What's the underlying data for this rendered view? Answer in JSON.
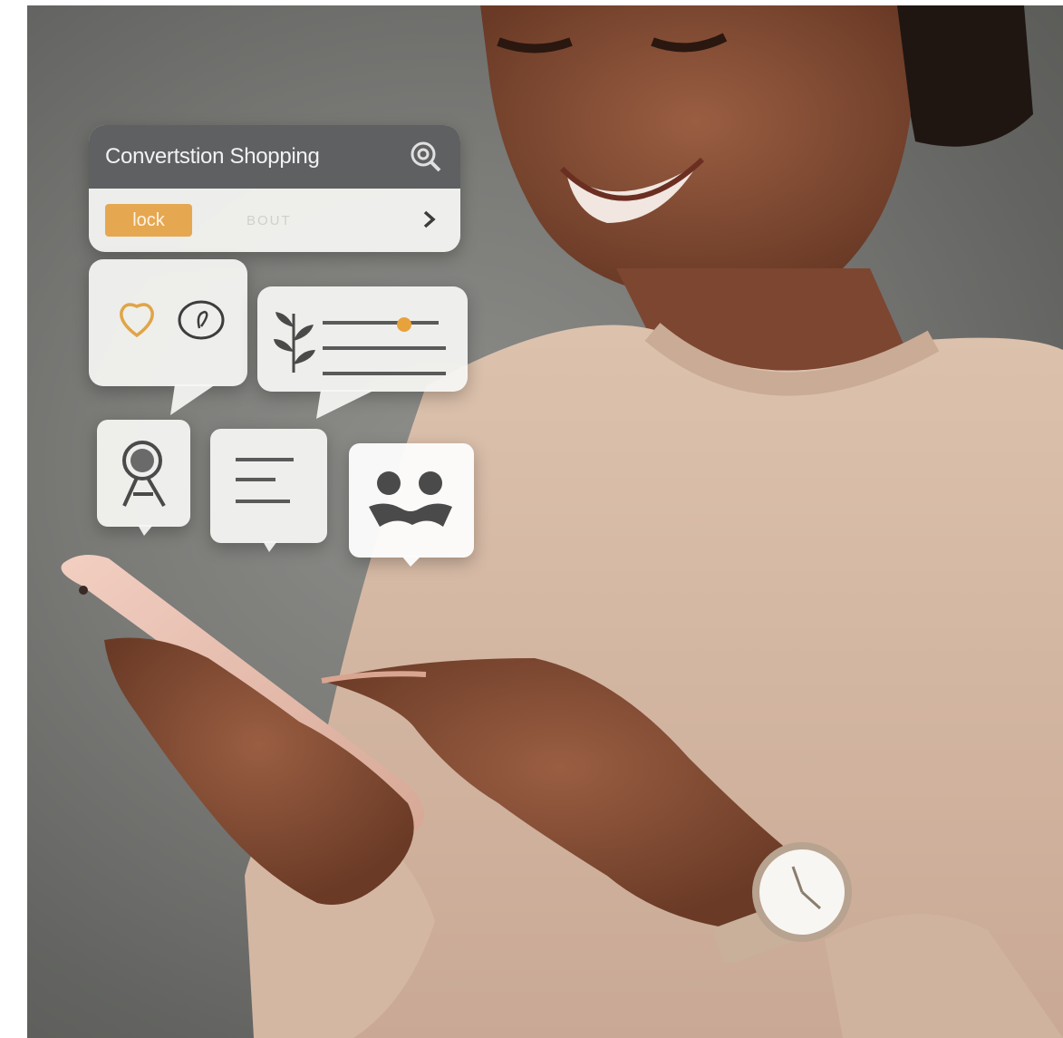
{
  "search_card": {
    "title": "Convertstion Shopping",
    "pill_label": "lock",
    "ghost_label": "BOUT"
  },
  "colors": {
    "accent": "#e6a751",
    "bar": "#5f6062",
    "sweater": "#d9bca7",
    "skin": "#8a5238",
    "wall": "#7a7a77"
  },
  "icons": [
    "search-icon",
    "chevron-right-icon",
    "heart-icon",
    "chat-icon",
    "leaf-icon",
    "slider-icon",
    "ribbon-icon",
    "text-lines-icon",
    "people-icon"
  ]
}
